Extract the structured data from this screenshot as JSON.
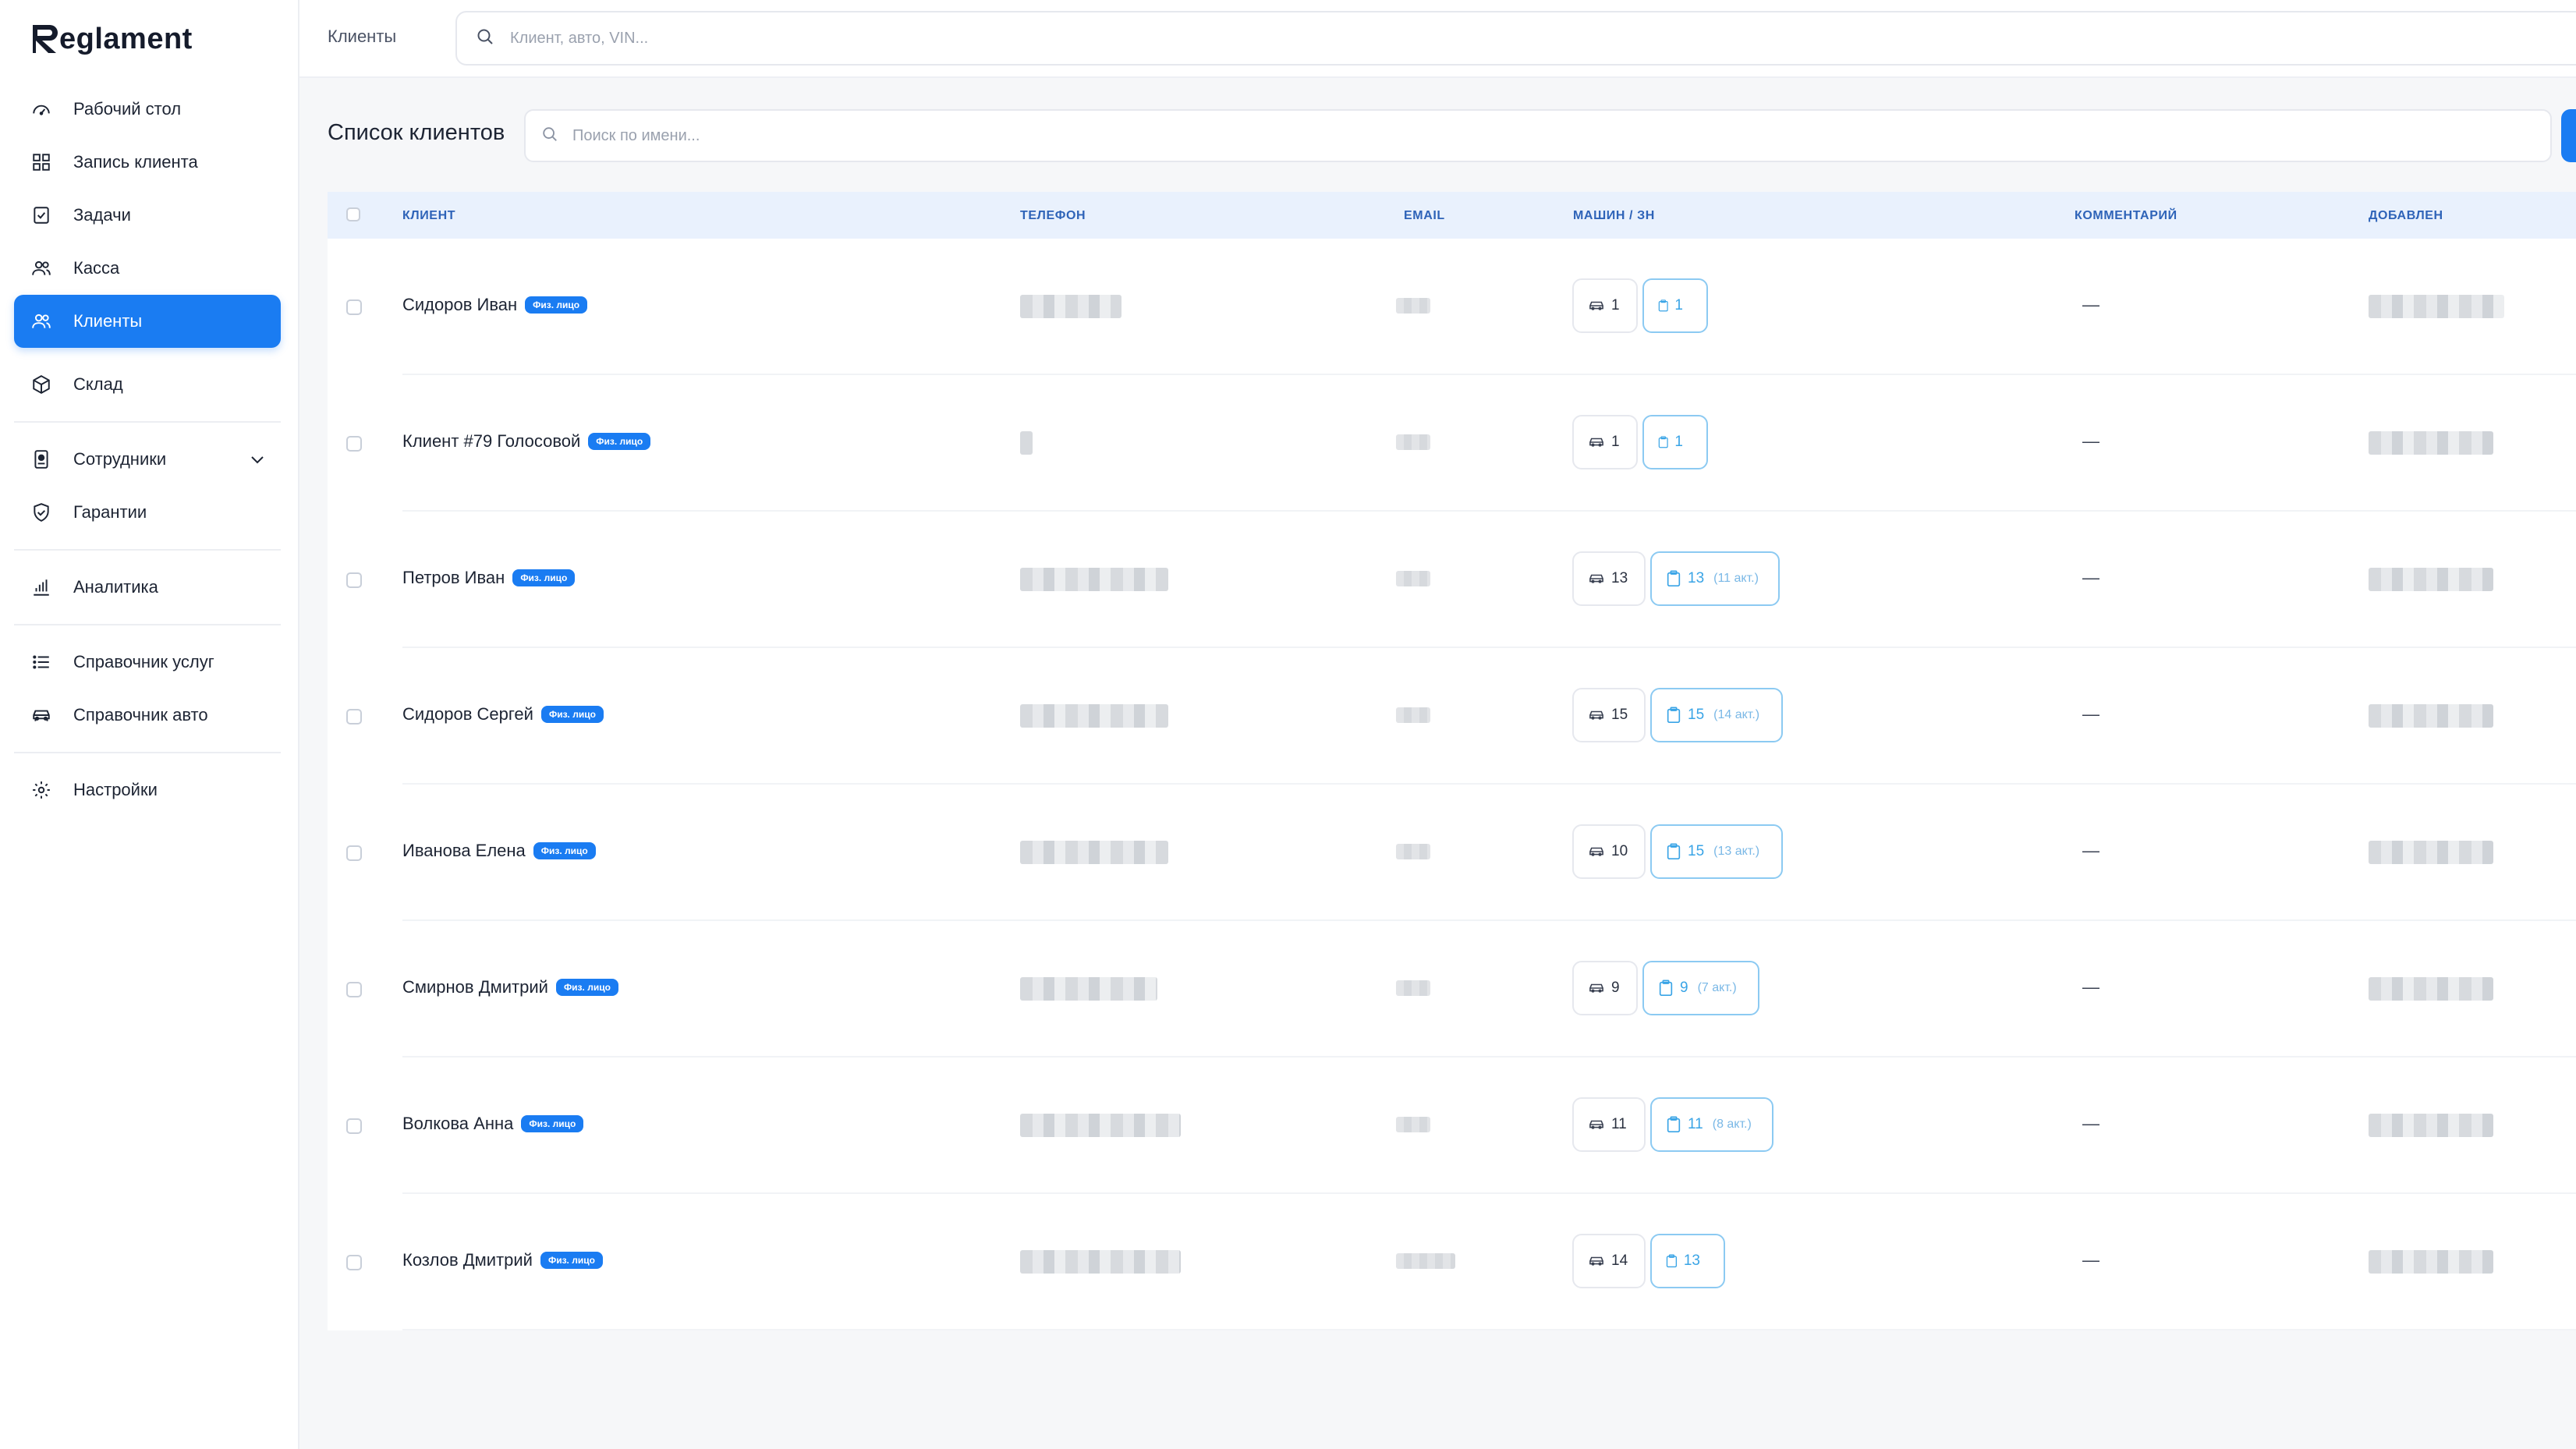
{
  "brand": {
    "name": "eglament",
    "mark": "R"
  },
  "sidebar": {
    "items": [
      {
        "label": "Рабочий стол",
        "icon": "dashboard-gauge-icon"
      },
      {
        "label": "Запись клиента",
        "icon": "grid-icon"
      },
      {
        "label": "Задачи",
        "icon": "task-checklist-icon"
      },
      {
        "label": "Касса",
        "icon": "users-icon"
      },
      {
        "label": "Клиенты",
        "icon": "users-icon",
        "active": true
      },
      {
        "label": "Склад",
        "icon": "box-icon"
      },
      {
        "label": "Сотрудники",
        "icon": "id-badge-icon",
        "expandable": true
      },
      {
        "label": "Гарантии",
        "icon": "shield-icon"
      },
      {
        "label": "Аналитика",
        "icon": "bar-chart-icon"
      },
      {
        "label": "Справочник услуг",
        "icon": "list-icon"
      },
      {
        "label": "Справочник авто",
        "icon": "car-icon"
      },
      {
        "label": "Настройки",
        "icon": "gear-icon"
      }
    ]
  },
  "topbar": {
    "breadcrumb": "Клиенты",
    "search_placeholder": "Клиент, авто, VIN..."
  },
  "page": {
    "title": "Список клиентов",
    "search_placeholder": "Поиск по имени..."
  },
  "table": {
    "columns": [
      "КЛИЕНТ",
      "ТЕЛЕФОН",
      "EMAIL",
      "МАШИН / ЗН",
      "КОММЕНТАРИЙ",
      "ДОБАВЛЕН"
    ],
    "rows": [
      {
        "name": "Сидоров Иван",
        "badge": "Физ. лицо",
        "cars": "1",
        "orders": "1",
        "active": "",
        "comment": "—"
      },
      {
        "name": "Клиент #79 Голосовой",
        "badge": "Физ. лицо",
        "cars": "1",
        "orders": "1",
        "active": "",
        "comment": "—"
      },
      {
        "name": "Петров Иван",
        "badge": "Физ. лицо",
        "cars": "13",
        "orders": "13",
        "active": "(11 акт.)",
        "comment": "—"
      },
      {
        "name": "Сидоров Сергей",
        "badge": "Физ. лицо",
        "cars": "15",
        "orders": "15",
        "active": "(14 акт.)",
        "comment": "—"
      },
      {
        "name": "Иванова Елена",
        "badge": "Физ. лицо",
        "cars": "10",
        "orders": "15",
        "active": "(13 акт.)",
        "comment": "—"
      },
      {
        "name": "Смирнов Дмитрий",
        "badge": "Физ. лицо",
        "cars": "9",
        "orders": "9",
        "active": "(7 акт.)",
        "comment": "—"
      },
      {
        "name": "Волкова Анна",
        "badge": "Физ. лицо",
        "cars": "11",
        "orders": "11",
        "active": "(8 акт.)",
        "comment": "—"
      },
      {
        "name": "Козлов Дмитрий",
        "badge": "Физ. лицо",
        "cars": "14",
        "orders": "13",
        "active": "",
        "comment": "—"
      }
    ]
  },
  "colors": {
    "accent": "#1a7cf2",
    "header_bg": "#e9f1fd",
    "header_text": "#2e63b8",
    "link_blue": "#39a4e6"
  }
}
